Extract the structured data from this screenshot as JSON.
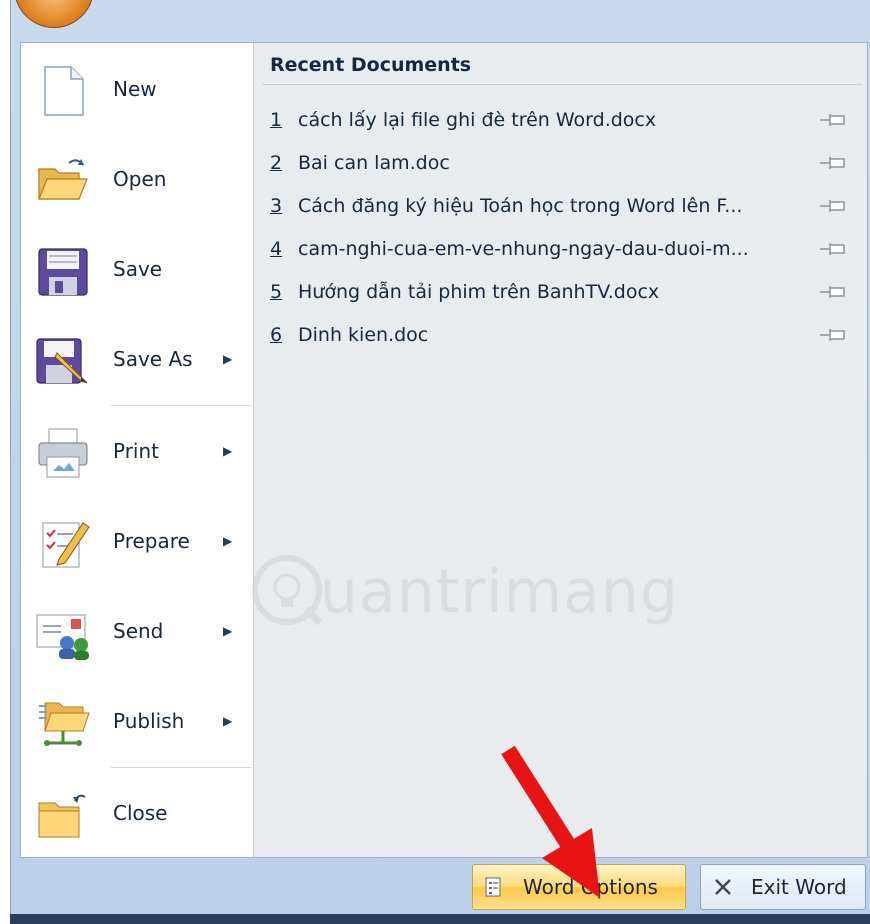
{
  "menu": {
    "items": [
      {
        "label": "New",
        "icon": "new-document-icon",
        "submenu": false
      },
      {
        "label": "Open",
        "icon": "open-folder-icon",
        "submenu": false
      },
      {
        "label": "Save",
        "icon": "save-floppy-icon",
        "submenu": false
      },
      {
        "label": "Save As",
        "icon": "save-as-icon",
        "submenu": true
      },
      {
        "label": "Print",
        "icon": "printer-icon",
        "submenu": true
      },
      {
        "label": "Prepare",
        "icon": "prepare-checklist-icon",
        "submenu": true
      },
      {
        "label": "Send",
        "icon": "send-mail-icon",
        "submenu": true
      },
      {
        "label": "Publish",
        "icon": "publish-folder-icon",
        "submenu": true
      },
      {
        "label": "Close",
        "icon": "close-folder-icon",
        "submenu": false
      }
    ]
  },
  "recent": {
    "title": "Recent Documents",
    "documents": [
      {
        "num": "1",
        "name": "cách lấy lại file ghi đè trên Word.docx"
      },
      {
        "num": "2",
        "name": "Bai can lam.doc"
      },
      {
        "num": "3",
        "name": "Cách đăng ký hiệu Toán học trong Word lên F..."
      },
      {
        "num": "4",
        "name": "cam-nghi-cua-em-ve-nhung-ngay-dau-duoi-m..."
      },
      {
        "num": "5",
        "name": "Hướng dẫn tải phim trên BanhTV.docx"
      },
      {
        "num": "6",
        "name": "Dinh kien.doc"
      }
    ]
  },
  "footer": {
    "word_options": "Word Options",
    "exit_word": "Exit Word"
  },
  "watermark": {
    "text": "uantrimang"
  },
  "colors": {
    "accent_arrow": "#e81414",
    "office_orb": "#e48a2a"
  }
}
